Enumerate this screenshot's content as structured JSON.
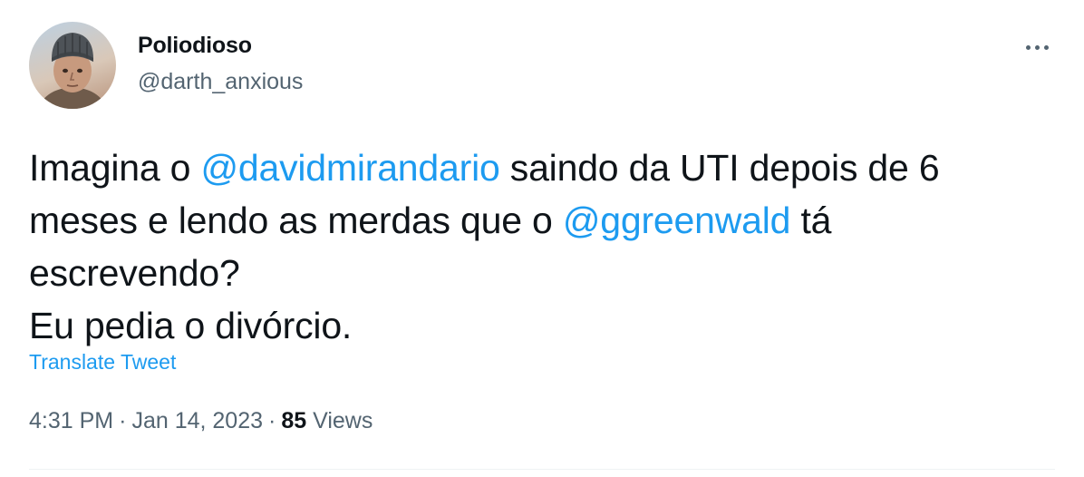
{
  "author": {
    "display_name": "Poliodioso",
    "handle": "@darth_anxious",
    "avatar_icon": "cartoon-portrait-avatar"
  },
  "more_icon": "more-options-icon",
  "tweet": {
    "line1": {
      "pre": "Imagina o ",
      "mention": "@davidmirandario",
      "post": " saindo da UTI depois de 6"
    },
    "line2": {
      "pre": "meses e lendo as merdas que o ",
      "mention": "@ggreenwald",
      "post": " tá"
    },
    "line3": "escrevendo?",
    "line4": "Eu pedia o divórcio."
  },
  "translate_label": "Translate Tweet",
  "meta": {
    "time": "4:31 PM",
    "separator": "·",
    "date": "Jan 14, 2023",
    "views_count": "85",
    "views_label": "Views"
  },
  "colors": {
    "text": "#0f1419",
    "secondary": "#536471",
    "link": "#1d9bf0",
    "divider": "#eff3f4"
  }
}
